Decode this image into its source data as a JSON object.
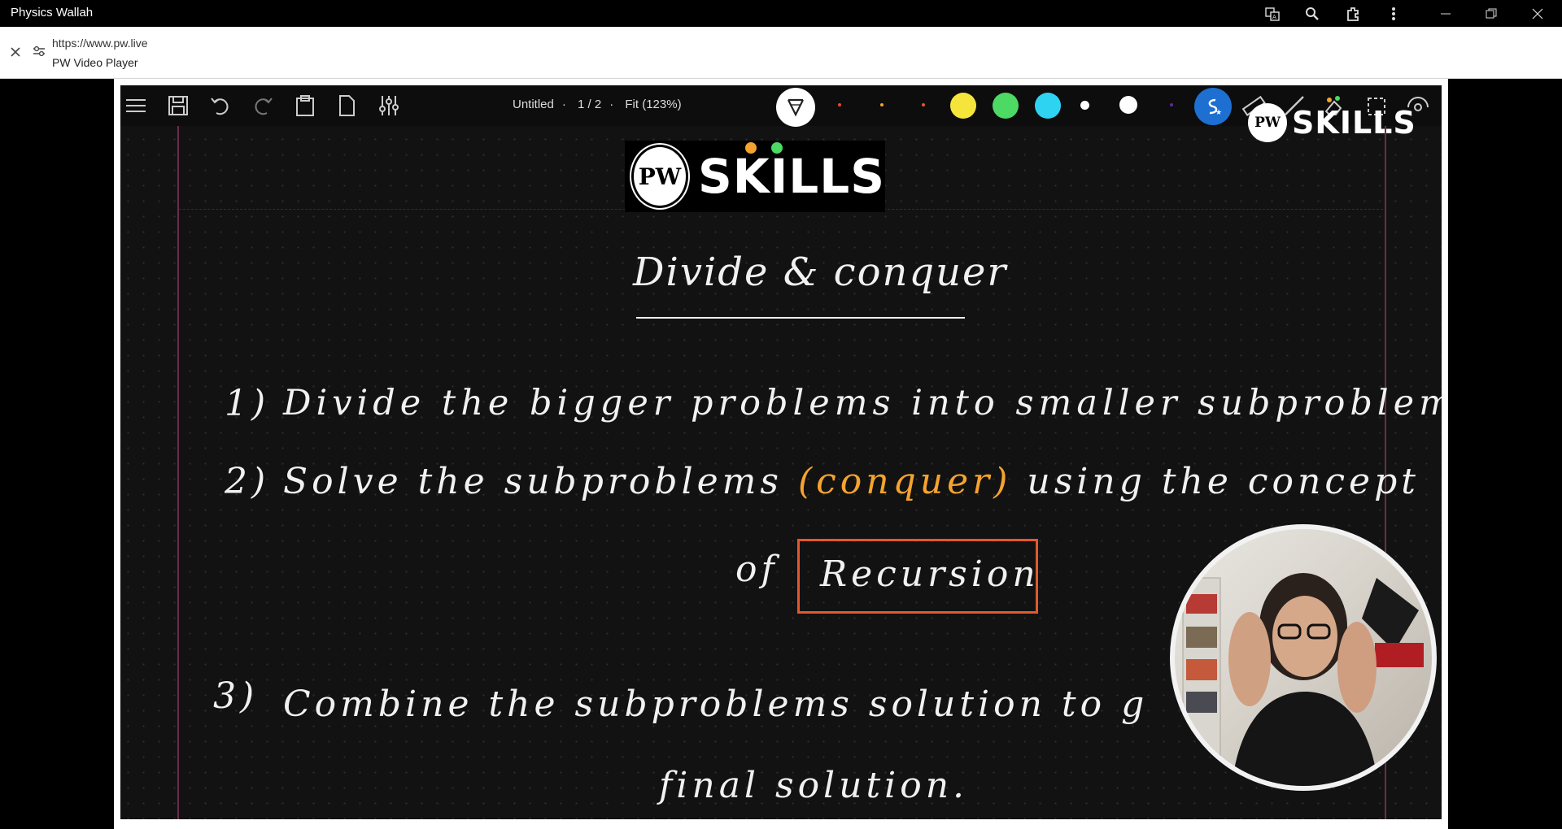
{
  "window": {
    "title": "Physics Wallah"
  },
  "address_bar": {
    "url": "https://www.pw.live",
    "page_name": "PW Video Player"
  },
  "toolbar": {
    "doc_name": "Untitled",
    "page_indicator": "1 / 2",
    "zoom": "Fit (123%)",
    "colors": [
      "#e64a2e",
      "#f5a32f",
      "#e4582a",
      "#f5e53b",
      "#4cd964",
      "#2fd3f2",
      "#ffffff",
      "#ffffff",
      "#5b2ca0"
    ]
  },
  "logo": {
    "badge": "PW",
    "wordmark": "SKILLS"
  },
  "board": {
    "heading": "Divide & conquer",
    "step1_num": "1)",
    "step1_text": "Divide the bigger problems into smaller subproblems",
    "step2_num": "2)",
    "step2_text_a": "Solve the subproblems",
    "step2_highlight": "(conquer)",
    "step2_text_b": "using the concept",
    "step2_of": "of",
    "step2_boxed": "Recursion",
    "step3_num": "3)",
    "step3_text": "Combine the subproblems solution to g",
    "step3_cont": "final solution."
  }
}
